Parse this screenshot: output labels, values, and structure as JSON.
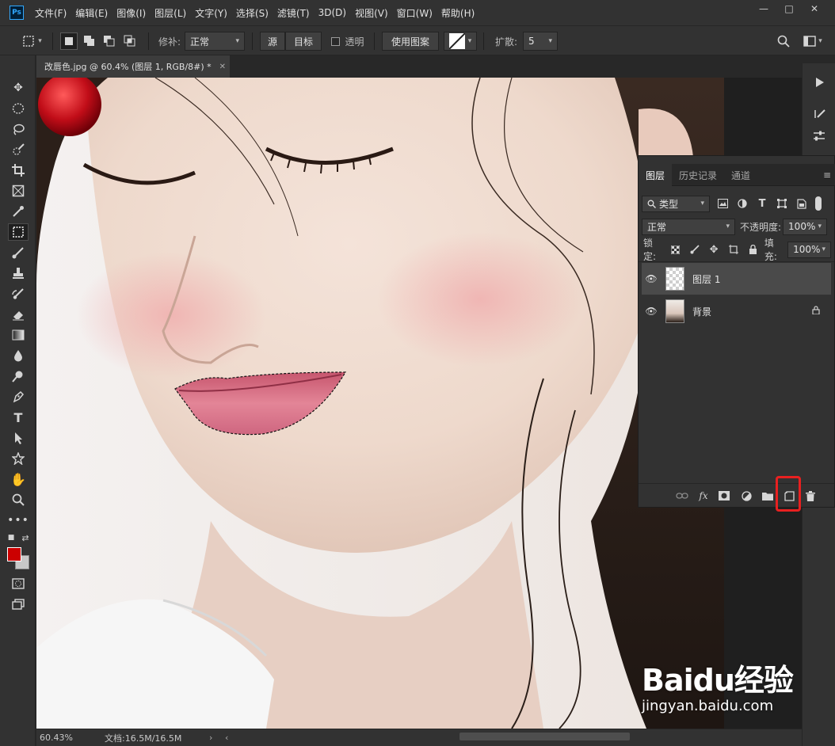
{
  "app": {
    "logo": "Ps"
  },
  "menu": [
    "文件(F)",
    "编辑(E)",
    "图像(I)",
    "图层(L)",
    "文字(Y)",
    "选择(S)",
    "滤镜(T)",
    "3D(D)",
    "视图(V)",
    "窗口(W)",
    "帮助(H)"
  ],
  "window_controls": {
    "minimize": "—",
    "restore": "□",
    "close": "✕"
  },
  "options": {
    "patch_label": "修补:",
    "patch_mode": "正常",
    "source_btn": "源",
    "target_btn": "目标",
    "transparent_label": "透明",
    "use_pattern_btn": "使用图案",
    "diffusion_label": "扩散:",
    "diffusion_value": "5"
  },
  "document": {
    "tab_title": "改唇色.jpg @ 60.4% (图层 1, RGB/8#) *",
    "close": "✕"
  },
  "layers_panel": {
    "tabs": [
      "图层",
      "历史记录",
      "通道"
    ],
    "filter_kind": "类型",
    "blend_mode": "正常",
    "opacity_label": "不透明度:",
    "opacity_value": "100%",
    "lock_label": "锁定:",
    "fill_label": "填充:",
    "fill_value": "100%",
    "layers": [
      {
        "name": "图层 1",
        "selected": true,
        "locked": false
      },
      {
        "name": "背景",
        "selected": false,
        "locked": true
      }
    ],
    "footer_icons": [
      "link-icon",
      "fx-icon",
      "mask-icon",
      "adjustment-icon",
      "folder-icon",
      "new-layer-icon",
      "trash-icon"
    ]
  },
  "status": {
    "zoom": "60.43%",
    "doc_info": "文档:16.5M/16.5M"
  },
  "watermark": {
    "logo": "Baidu经验",
    "url": "jingyan.baidu.com"
  },
  "colors": {
    "foreground": "#cc0000",
    "background": "#c8c8c8",
    "highlight": "#e82020"
  }
}
